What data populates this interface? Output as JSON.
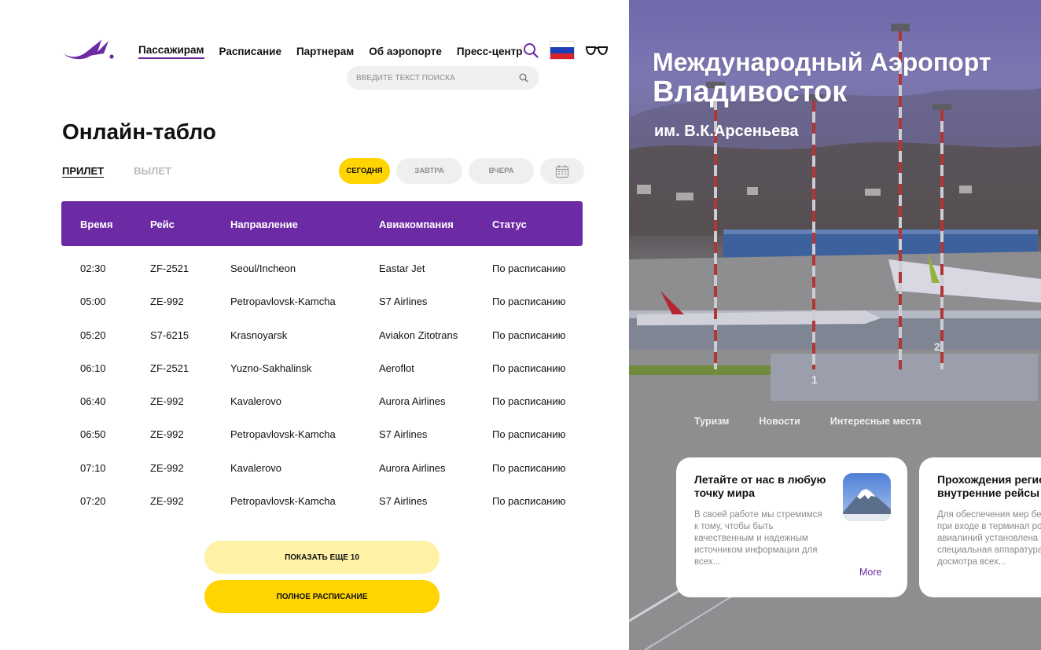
{
  "nav": {
    "items": [
      "Пассажирам",
      "Расписание",
      "Партнерам",
      "Об аэропорте",
      "Пресс-центр"
    ],
    "active": "Пассажирам"
  },
  "search": {
    "placeholder": "ВВЕДИТЕ ТЕКСТ ПОИСКА"
  },
  "page_title": "Онлайн-табло",
  "direction_tabs": {
    "arrival": "ПРИЛЕТ",
    "departure": "ВЫЛЕТ",
    "active": "arrival"
  },
  "day_tabs": {
    "today": "СЕГОДНЯ",
    "tomorrow": "ЗАВТРА",
    "yesterday": "ВЧЕРА",
    "active": "today"
  },
  "table": {
    "headers": {
      "time": "Время",
      "flight": "Рейс",
      "direction": "Направление",
      "airline": "Авиакомпания",
      "status": "Статус"
    },
    "rows": [
      {
        "time": "02:30",
        "flight": "ZF-2521",
        "direction": "Seoul/Incheon",
        "airline": "Eastar Jet",
        "status": "По расписанию"
      },
      {
        "time": "05:00",
        "flight": "ZE-992",
        "direction": "Petropavlovsk-Kamcha",
        "airline": "S7 Airlines",
        "status": "По расписанию"
      },
      {
        "time": "05:20",
        "flight": "S7-6215",
        "direction": "Krasnoyarsk",
        "airline": "Aviakon Zitotrans",
        "status": "По расписанию"
      },
      {
        "time": "06:10",
        "flight": "ZF-2521",
        "direction": "Yuzno-Sakhalinsk",
        "airline": "Aeroflot",
        "status": "По расписанию"
      },
      {
        "time": "06:40",
        "flight": "ZE-992",
        "direction": "Kavalerovo",
        "airline": "Aurora Airlines",
        "status": "По расписанию"
      },
      {
        "time": "06:50",
        "flight": "ZE-992",
        "direction": "Petropavlovsk-Kamcha",
        "airline": "S7 Airlines",
        "status": "По расписанию"
      },
      {
        "time": "07:10",
        "flight": "ZE-992",
        "direction": "Kavalerovo",
        "airline": "Aurora Airlines",
        "status": "По расписанию"
      },
      {
        "time": "07:20",
        "flight": "ZE-992",
        "direction": "Petropavlovsk-Kamcha",
        "airline": "S7 Airlines",
        "status": "По расписанию"
      }
    ]
  },
  "buttons": {
    "show_more": "ПОКАЗАТЬ ЕЩЕ 10",
    "full_schedule": "ПОЛНОЕ РАСПИСАНИЕ"
  },
  "hero": {
    "title_line1": "Международный Аэропорт",
    "title_line2": "Владивосток",
    "subtitle": "им. В.К.Арсеньева"
  },
  "categories": [
    "Туризм",
    "Новости",
    "Интересные места"
  ],
  "cards": [
    {
      "title": "Летайте от нас в любую точку мира",
      "text": "В своей работе мы стремимся к тому, чтобы быть качественным и надежным источником информации для всех...",
      "more": "More"
    },
    {
      "title": "Прохождения регистрации на внутренние рейсы",
      "text": "Для обеспечения мер безопасности, при входе в терминал российских авиалиний установлена специальная аппаратура для досмотра всех..."
    }
  ],
  "colors": {
    "brand_purple": "#6c2aa5",
    "accent_yellow": "#ffd400",
    "light_yellow": "#fff1a6"
  },
  "icons": [
    "logo-icon",
    "search-icon",
    "russia-flag-icon",
    "glasses-icon",
    "calendar-icon"
  ]
}
